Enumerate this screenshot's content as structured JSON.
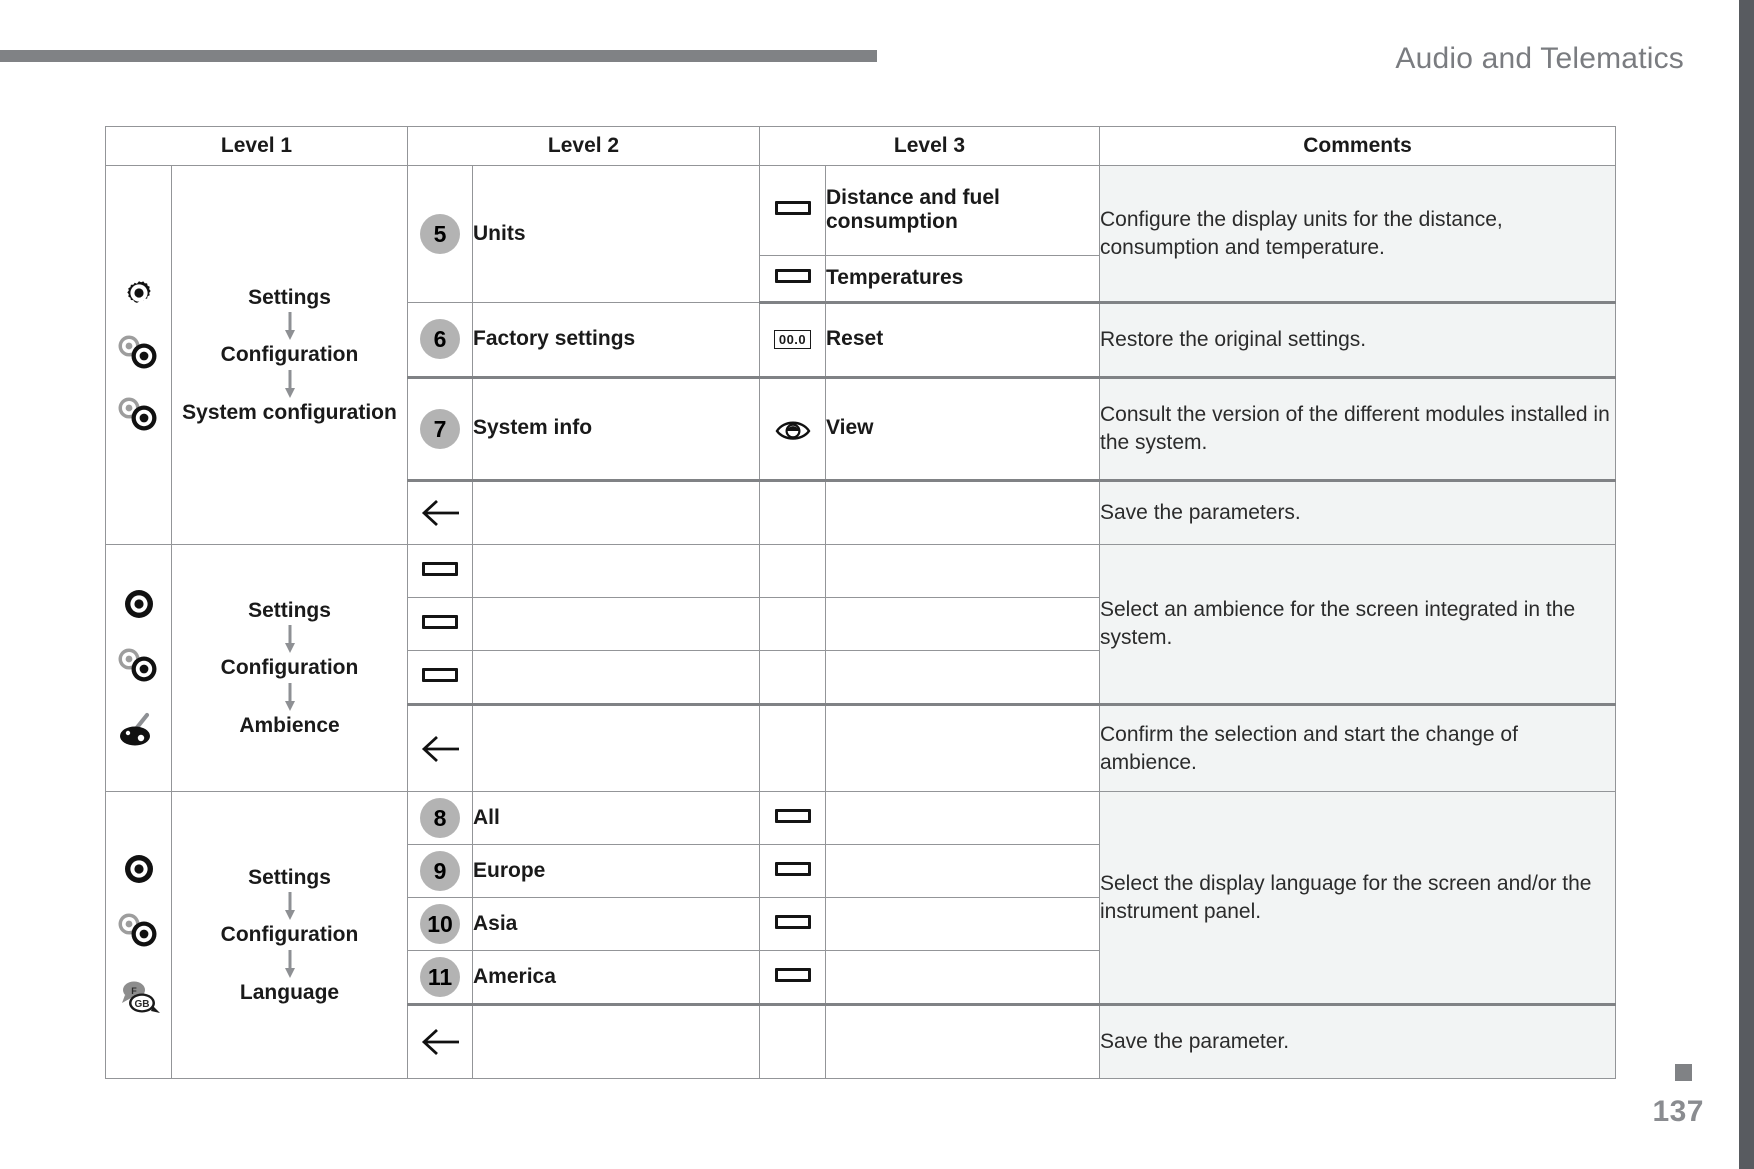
{
  "header": {
    "title": "Audio and Telematics",
    "page_number": "137"
  },
  "table": {
    "columns": [
      "Level 1",
      "Level 2",
      "Level 3",
      "Comments"
    ],
    "groups": [
      {
        "id": "system-configuration",
        "icons": [
          "gear-icon",
          "two-gears-icon",
          "two-gears-icon"
        ],
        "path": [
          "Settings",
          "Configuration",
          "System configuration"
        ],
        "rows": [
          {
            "number": "5",
            "level2": "Units",
            "level3_items": [
              {
                "icon": "bar-icon",
                "label": "Distance and fuel consumption"
              },
              {
                "icon": "bar-icon",
                "label": "Temperatures"
              }
            ],
            "comment": "Configure the display units for the distance, consumption and temperature."
          },
          {
            "number": "6",
            "level2": "Factory settings",
            "level3_items": [
              {
                "icon": "reset-counter-icon",
                "icon_text": "00.0",
                "label": "Reset"
              }
            ],
            "comment": "Restore the original settings."
          },
          {
            "number": "7",
            "level2": "System info",
            "level3_items": [
              {
                "icon": "eye-icon",
                "label": "View"
              }
            ],
            "comment": "Consult the version of the different modules installed in the system."
          },
          {
            "number": "back-arrow-icon",
            "level2": "",
            "level3_items": [
              {
                "icon": "",
                "label": ""
              }
            ],
            "comment": "Save the parameters."
          }
        ]
      },
      {
        "id": "ambience",
        "icons": [
          "gear-icon",
          "two-gears-icon",
          "palette-icon"
        ],
        "path": [
          "Settings",
          "Configuration",
          "Ambience"
        ],
        "rows": [
          {
            "number": "bar-icon",
            "level2": "",
            "level3_items": [
              {
                "icon": "",
                "label": ""
              }
            ],
            "comment": "Select an ambience for the screen integrated in the system."
          },
          {
            "number": "bar-icon",
            "level2": "",
            "level3_items": [
              {
                "icon": "",
                "label": ""
              }
            ],
            "comment": ""
          },
          {
            "number": "bar-icon",
            "level2": "",
            "level3_items": [
              {
                "icon": "",
                "label": ""
              }
            ],
            "comment": ""
          },
          {
            "number": "back-arrow-icon",
            "level2": "",
            "level3_items": [
              {
                "icon": "",
                "label": ""
              }
            ],
            "comment": "Confirm the selection and start the change of ambience."
          }
        ]
      },
      {
        "id": "language",
        "icons": [
          "gear-icon",
          "two-gears-icon",
          "speech-bubbles-icon"
        ],
        "path": [
          "Settings",
          "Configuration",
          "Language"
        ],
        "rows": [
          {
            "number": "8",
            "level2": "All",
            "level3_items": [
              {
                "icon": "bar-icon",
                "label": ""
              }
            ],
            "comment": "Select the display language for the screen and/or the instrument panel."
          },
          {
            "number": "9",
            "level2": "Europe",
            "level3_items": [
              {
                "icon": "bar-icon",
                "label": ""
              }
            ],
            "comment": ""
          },
          {
            "number": "10",
            "level2": "Asia",
            "level3_items": [
              {
                "icon": "bar-icon",
                "label": ""
              }
            ],
            "comment": ""
          },
          {
            "number": "11",
            "level2": "America",
            "level3_items": [
              {
                "icon": "bar-icon",
                "label": ""
              }
            ],
            "comment": ""
          },
          {
            "number": "back-arrow-icon",
            "level2": "",
            "level3_items": [
              {
                "icon": "",
                "label": ""
              }
            ],
            "comment": "Save the parameter."
          }
        ]
      }
    ]
  },
  "language_icon_labels": {
    "top": "F",
    "bottom": "GB"
  },
  "colors": {
    "header_rule": "#808285",
    "right_bar": "#585b60",
    "table_border": "#939598",
    "group_border": "#808285",
    "head_bg": "#e6e7e8",
    "comment_bg": "#f2f4f4",
    "badge_bg": "#b3b3b3"
  }
}
